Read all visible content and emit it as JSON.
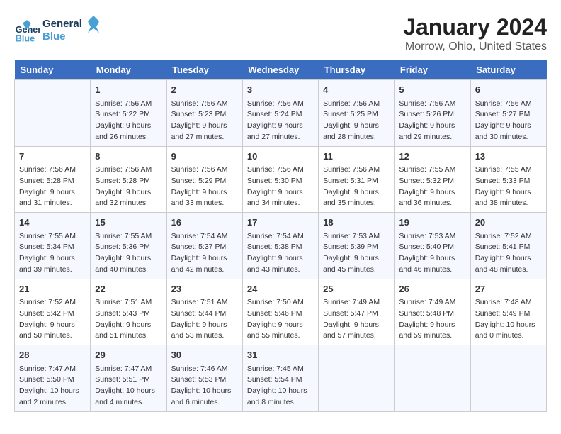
{
  "logo": {
    "line1": "General",
    "line2": "Blue"
  },
  "title": "January 2024",
  "subtitle": "Morrow, Ohio, United States",
  "header_color": "#3a6cbf",
  "days_of_week": [
    "Sunday",
    "Monday",
    "Tuesday",
    "Wednesday",
    "Thursday",
    "Friday",
    "Saturday"
  ],
  "weeks": [
    [
      {
        "day": "",
        "content": ""
      },
      {
        "day": "1",
        "content": "Sunrise: 7:56 AM\nSunset: 5:22 PM\nDaylight: 9 hours\nand 26 minutes."
      },
      {
        "day": "2",
        "content": "Sunrise: 7:56 AM\nSunset: 5:23 PM\nDaylight: 9 hours\nand 27 minutes."
      },
      {
        "day": "3",
        "content": "Sunrise: 7:56 AM\nSunset: 5:24 PM\nDaylight: 9 hours\nand 27 minutes."
      },
      {
        "day": "4",
        "content": "Sunrise: 7:56 AM\nSunset: 5:25 PM\nDaylight: 9 hours\nand 28 minutes."
      },
      {
        "day": "5",
        "content": "Sunrise: 7:56 AM\nSunset: 5:26 PM\nDaylight: 9 hours\nand 29 minutes."
      },
      {
        "day": "6",
        "content": "Sunrise: 7:56 AM\nSunset: 5:27 PM\nDaylight: 9 hours\nand 30 minutes."
      }
    ],
    [
      {
        "day": "7",
        "content": "Sunrise: 7:56 AM\nSunset: 5:28 PM\nDaylight: 9 hours\nand 31 minutes."
      },
      {
        "day": "8",
        "content": "Sunrise: 7:56 AM\nSunset: 5:28 PM\nDaylight: 9 hours\nand 32 minutes."
      },
      {
        "day": "9",
        "content": "Sunrise: 7:56 AM\nSunset: 5:29 PM\nDaylight: 9 hours\nand 33 minutes."
      },
      {
        "day": "10",
        "content": "Sunrise: 7:56 AM\nSunset: 5:30 PM\nDaylight: 9 hours\nand 34 minutes."
      },
      {
        "day": "11",
        "content": "Sunrise: 7:56 AM\nSunset: 5:31 PM\nDaylight: 9 hours\nand 35 minutes."
      },
      {
        "day": "12",
        "content": "Sunrise: 7:55 AM\nSunset: 5:32 PM\nDaylight: 9 hours\nand 36 minutes."
      },
      {
        "day": "13",
        "content": "Sunrise: 7:55 AM\nSunset: 5:33 PM\nDaylight: 9 hours\nand 38 minutes."
      }
    ],
    [
      {
        "day": "14",
        "content": "Sunrise: 7:55 AM\nSunset: 5:34 PM\nDaylight: 9 hours\nand 39 minutes."
      },
      {
        "day": "15",
        "content": "Sunrise: 7:55 AM\nSunset: 5:36 PM\nDaylight: 9 hours\nand 40 minutes."
      },
      {
        "day": "16",
        "content": "Sunrise: 7:54 AM\nSunset: 5:37 PM\nDaylight: 9 hours\nand 42 minutes."
      },
      {
        "day": "17",
        "content": "Sunrise: 7:54 AM\nSunset: 5:38 PM\nDaylight: 9 hours\nand 43 minutes."
      },
      {
        "day": "18",
        "content": "Sunrise: 7:53 AM\nSunset: 5:39 PM\nDaylight: 9 hours\nand 45 minutes."
      },
      {
        "day": "19",
        "content": "Sunrise: 7:53 AM\nSunset: 5:40 PM\nDaylight: 9 hours\nand 46 minutes."
      },
      {
        "day": "20",
        "content": "Sunrise: 7:52 AM\nSunset: 5:41 PM\nDaylight: 9 hours\nand 48 minutes."
      }
    ],
    [
      {
        "day": "21",
        "content": "Sunrise: 7:52 AM\nSunset: 5:42 PM\nDaylight: 9 hours\nand 50 minutes."
      },
      {
        "day": "22",
        "content": "Sunrise: 7:51 AM\nSunset: 5:43 PM\nDaylight: 9 hours\nand 51 minutes."
      },
      {
        "day": "23",
        "content": "Sunrise: 7:51 AM\nSunset: 5:44 PM\nDaylight: 9 hours\nand 53 minutes."
      },
      {
        "day": "24",
        "content": "Sunrise: 7:50 AM\nSunset: 5:46 PM\nDaylight: 9 hours\nand 55 minutes."
      },
      {
        "day": "25",
        "content": "Sunrise: 7:49 AM\nSunset: 5:47 PM\nDaylight: 9 hours\nand 57 minutes."
      },
      {
        "day": "26",
        "content": "Sunrise: 7:49 AM\nSunset: 5:48 PM\nDaylight: 9 hours\nand 59 minutes."
      },
      {
        "day": "27",
        "content": "Sunrise: 7:48 AM\nSunset: 5:49 PM\nDaylight: 10 hours\nand 0 minutes."
      }
    ],
    [
      {
        "day": "28",
        "content": "Sunrise: 7:47 AM\nSunset: 5:50 PM\nDaylight: 10 hours\nand 2 minutes."
      },
      {
        "day": "29",
        "content": "Sunrise: 7:47 AM\nSunset: 5:51 PM\nDaylight: 10 hours\nand 4 minutes."
      },
      {
        "day": "30",
        "content": "Sunrise: 7:46 AM\nSunset: 5:53 PM\nDaylight: 10 hours\nand 6 minutes."
      },
      {
        "day": "31",
        "content": "Sunrise: 7:45 AM\nSunset: 5:54 PM\nDaylight: 10 hours\nand 8 minutes."
      },
      {
        "day": "",
        "content": ""
      },
      {
        "day": "",
        "content": ""
      },
      {
        "day": "",
        "content": ""
      }
    ]
  ]
}
